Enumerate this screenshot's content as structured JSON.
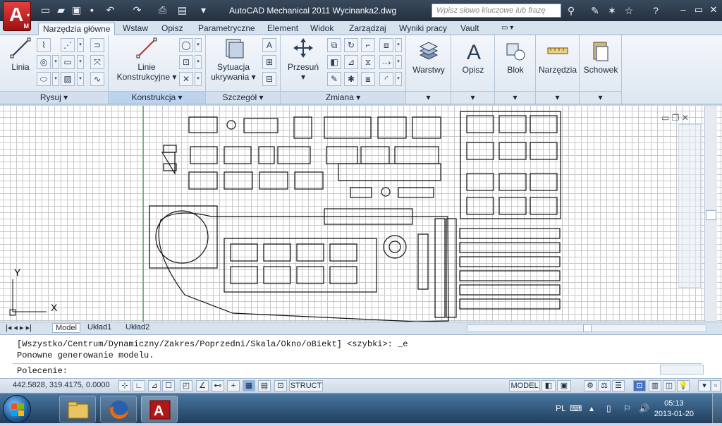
{
  "window": {
    "title": "AutoCAD Mechanical 2011    Wycinanka2.dwg",
    "search_placeholder": "Wpisz słowo kluczowe lub frazę"
  },
  "tabs": [
    "Narzędzia główne",
    "Wstaw",
    "Opisz",
    "Parametryczne",
    "Element",
    "Widok",
    "Zarządzaj",
    "Wyniki pracy",
    "Vault"
  ],
  "panels": {
    "rysuj": {
      "label": "Rysuj",
      "linia": "Linia"
    },
    "konstrukcja": {
      "label": "Konstrukcja",
      "linie_line1": "Linie",
      "linie_line2": "Konstrukcyjne"
    },
    "szczegol": {
      "label": "Szczegół",
      "sytuacja_line1": "Sytuacja",
      "sytuacja_line2": "ukrywania"
    },
    "zmiana": {
      "label": "Zmiana",
      "przesun": "Przesuń"
    },
    "big": {
      "warstwy": "Warstwy",
      "opisz": "Opisz",
      "blok": "Blok",
      "narzedzia": "Narzędzia",
      "schowek": "Schowek"
    }
  },
  "layout_tabs": [
    "Model",
    "Układ1",
    "Układ2"
  ],
  "command": {
    "line1": "[Wszystko/Centrum/Dynamiczny/Zakres/Poprzedni/Skala/Okno/oBiekt] <szybki>: _e",
    "line2": "Ponowne generowanie modelu.",
    "prompt": "Polecenie:"
  },
  "status": {
    "coords": "442.5828, 319.4175, 0.0000",
    "struct": "STRUCT",
    "model": "MODEL"
  },
  "ucs": {
    "x": "X",
    "y": "Y"
  },
  "tray": {
    "lang": "PL",
    "time": "05:13",
    "date": "2013-01-20"
  }
}
